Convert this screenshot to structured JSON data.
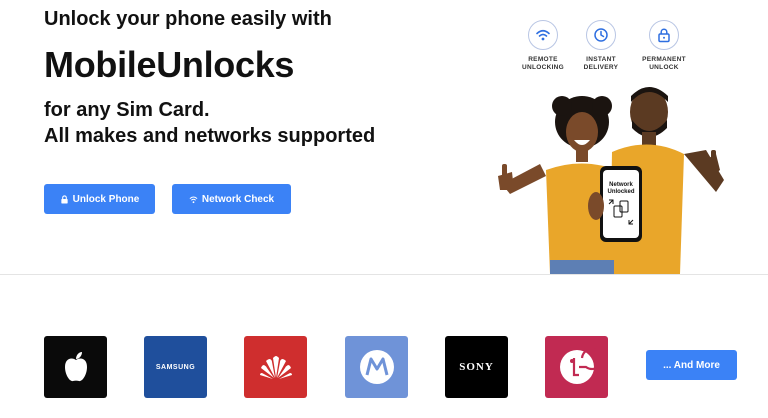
{
  "hero": {
    "line1": "Unlock your phone easily with",
    "brand_name": "MobileUnlocks",
    "line3": "for any Sim Card.",
    "line4": "All makes and networks supported",
    "unlock_button": "Unlock Phone",
    "network_button": "Network Check"
  },
  "features": [
    {
      "icon": "wifi-icon",
      "line1": "REMOTE",
      "line2": "UNLOCKING"
    },
    {
      "icon": "clock-icon",
      "line1": "INSTANT",
      "line2": "DELIVERY"
    },
    {
      "icon": "lock-icon",
      "line1": "PERMANENT",
      "line2": "UNLOCK"
    }
  ],
  "phone_screen": {
    "line1": "Network",
    "line2": "Unlocked"
  },
  "brands": [
    {
      "name": "apple",
      "color": "#0a0a0a"
    },
    {
      "name": "samsung",
      "label": "SAMSUNG",
      "color": "#1f4f9c"
    },
    {
      "name": "huawei",
      "color": "#cf2e2e"
    },
    {
      "name": "motorola",
      "color": "#6f93d8"
    },
    {
      "name": "sony",
      "label": "SONY",
      "color": "#000000"
    },
    {
      "name": "lg",
      "color": "#c12a52"
    }
  ],
  "more_button": "... And More",
  "colors": {
    "accent": "#3b82f6",
    "shirt": "#e9a62a"
  }
}
